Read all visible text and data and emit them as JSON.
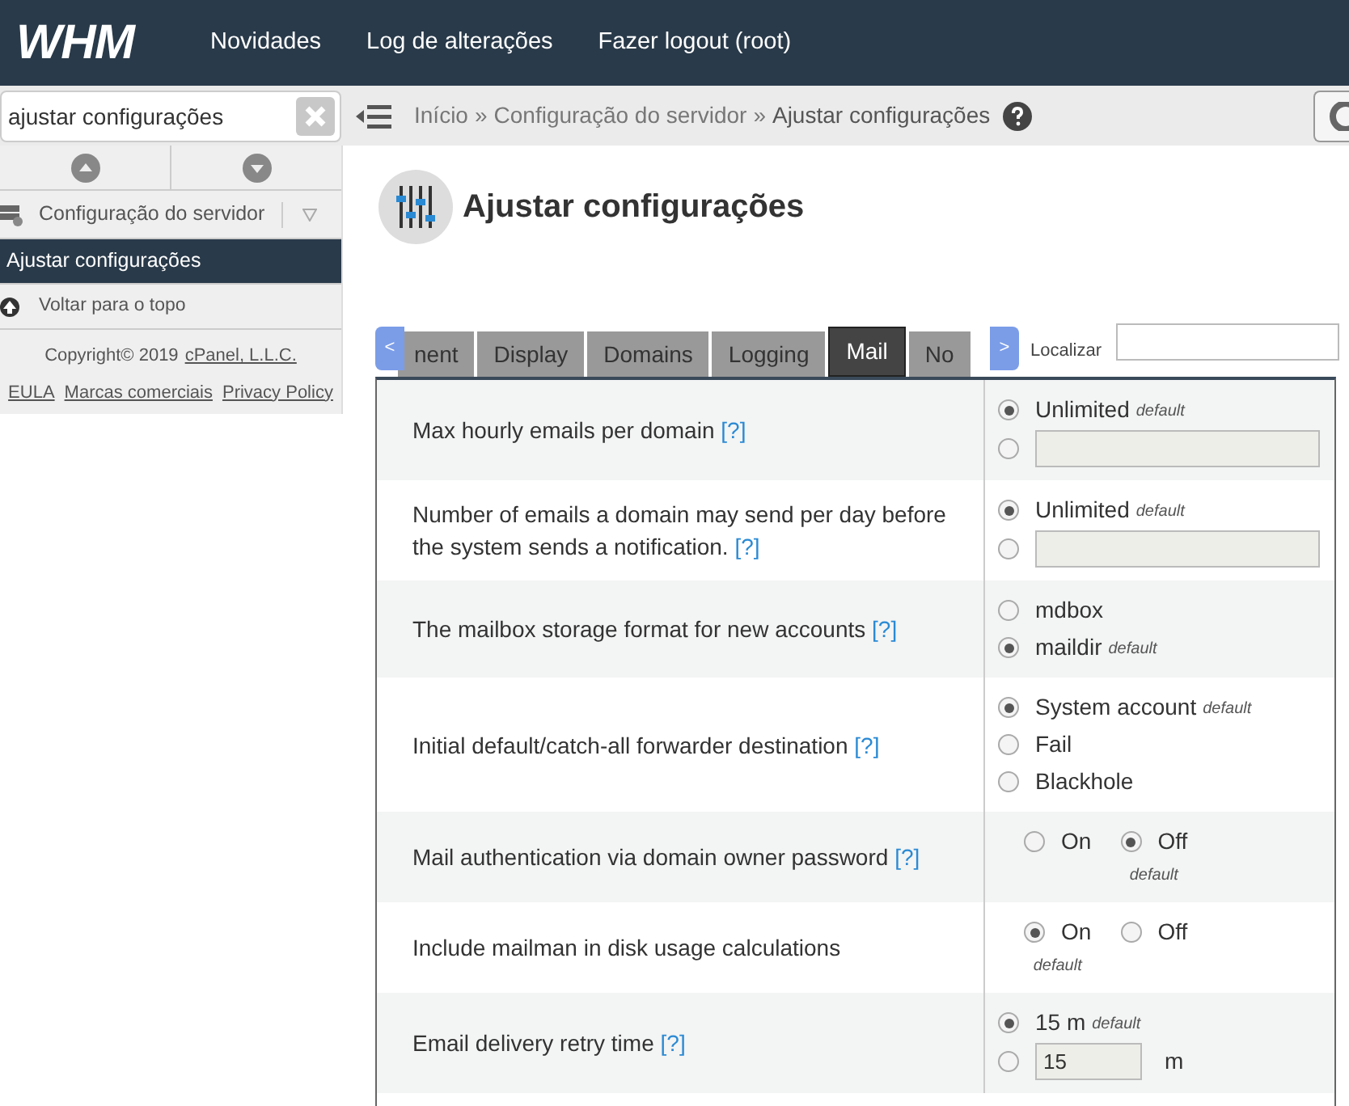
{
  "header": {
    "logo": "WHM",
    "nav": [
      "Novidades",
      "Log de alterações",
      "Fazer logout (root)"
    ]
  },
  "sidebar": {
    "search": {
      "value": "ajustar configurações"
    },
    "category": "Configuração do servidor",
    "items": [
      {
        "label": "Ajustar configurações",
        "selected": true
      }
    ],
    "back_to_top": "Voltar para o topo",
    "copyright": "Copyright© 2019",
    "copyright_link": "cPanel, L.L.C.",
    "links": [
      "EULA",
      "Marcas comerciais",
      "Privacy Policy"
    ]
  },
  "breadcrumb": [
    {
      "label": "Início",
      "separator": "»"
    },
    {
      "label": "Configuração do servidor",
      "separator": "»"
    },
    {
      "label": "Ajustar configurações"
    }
  ],
  "page_title": "Ajustar configurações",
  "tabs": [
    {
      "label": "nent",
      "selected": false
    },
    {
      "label": "Display",
      "selected": false
    },
    {
      "label": "Domains",
      "selected": false
    },
    {
      "label": "Logging",
      "selected": false
    },
    {
      "label": "Mail",
      "selected": true
    },
    {
      "label": "No",
      "selected": false
    }
  ],
  "tab_prev": "<",
  "tab_next": ">",
  "find": {
    "label": "Localizar"
  },
  "settings": [
    {
      "label": "Max hourly emails per domain",
      "help": "[?]",
      "inline": false,
      "options": [
        {
          "kind": "radio",
          "label": "Unlimited",
          "note": "default",
          "selected": true
        },
        {
          "kind": "field",
          "selected": false
        }
      ]
    },
    {
      "label": "Number of emails a domain may send per day before the system sends a notification.",
      "help": "[?]",
      "inline": false,
      "options": [
        {
          "kind": "radio",
          "label": "Unlimited",
          "note": "default",
          "selected": true
        },
        {
          "kind": "field",
          "selected": false
        }
      ]
    },
    {
      "label": "The mailbox storage format for new accounts",
      "help": "[?]",
      "inline": false,
      "options": [
        {
          "kind": "radio",
          "label": "mdbox",
          "selected": false
        },
        {
          "kind": "radio",
          "label": "maildir",
          "note": "default",
          "selected": true
        }
      ]
    },
    {
      "label": "Initial default/catch-all forwarder destination",
      "help": "[?]",
      "inline": false,
      "options": [
        {
          "kind": "radio",
          "label": "System account",
          "note": "default",
          "selected": true
        },
        {
          "kind": "radio",
          "label": "Fail",
          "selected": false
        },
        {
          "kind": "radio",
          "label": "Blackhole",
          "selected": false
        }
      ]
    },
    {
      "label": "Mail authentication via domain owner password",
      "help": "[?]",
      "inline": true,
      "options": [
        {
          "kind": "radio",
          "label": "On",
          "selected": false
        },
        {
          "kind": "radio",
          "label": "Off",
          "note": "default",
          "selected": true
        }
      ]
    },
    {
      "label": "Include mailman in disk usage calculations",
      "inline": true,
      "options": [
        {
          "kind": "radio",
          "label": "On",
          "note": "default",
          "selected": true
        },
        {
          "kind": "radio",
          "label": "Off",
          "selected": false
        }
      ]
    },
    {
      "label": "Email delivery retry time",
      "help": "[?]",
      "inline": false,
      "options": [
        {
          "kind": "radio",
          "label": "15 m",
          "note": "default",
          "selected": true
        },
        {
          "kind": "field",
          "value": "15",
          "unit": "m",
          "selected": false
        }
      ]
    }
  ]
}
